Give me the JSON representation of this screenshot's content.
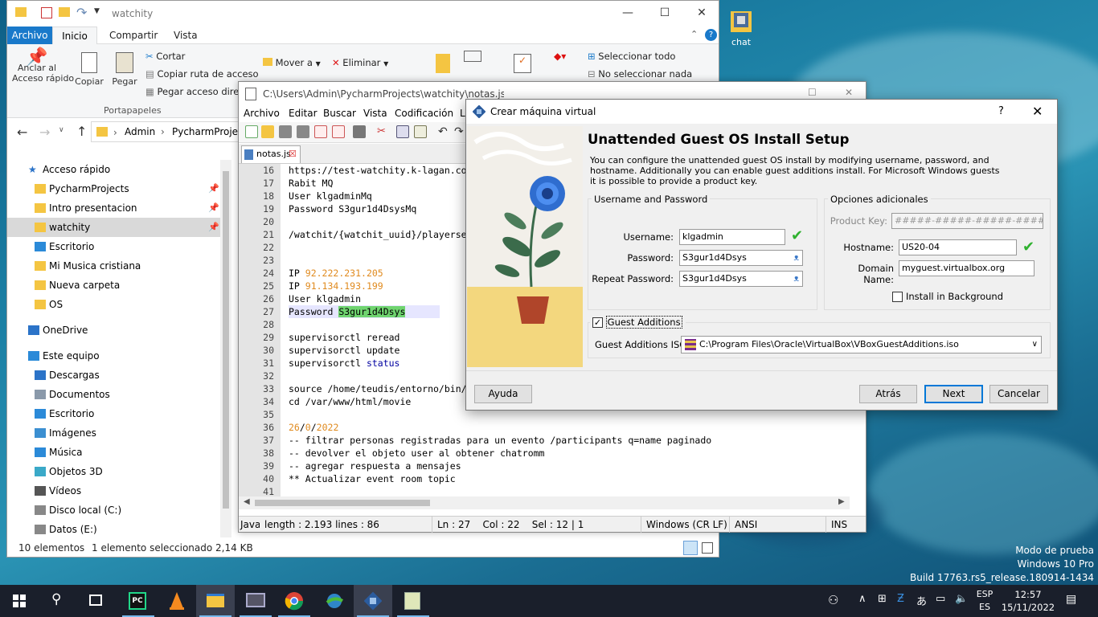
{
  "explorer": {
    "title": "watchity",
    "tabs": [
      "Archivo",
      "Inicio",
      "Compartir",
      "Vista"
    ],
    "ribbon": {
      "pin_label": "Anclar al\nAcceso rápido",
      "copy_label": "Copiar",
      "paste_label": "Pegar",
      "cut_label": "Cortar",
      "copy_path_label": "Copiar ruta de acceso",
      "paste_shortcut_label": "Pegar acceso direct",
      "group_clipboard": "Portapapeles",
      "move_label": "Mover a",
      "delete_label": "Eliminar",
      "select_all_label": "Seleccionar todo",
      "select_none_label": "No seleccionar nada"
    },
    "breadcrumb": [
      "Admin",
      "PycharmProject"
    ],
    "sidebar": [
      {
        "label": "Acceso rápido",
        "icon": "star-icon"
      },
      {
        "label": "PycharmProjects",
        "icon": "folder-icon"
      },
      {
        "label": "Intro presentacion",
        "icon": "folder-icon"
      },
      {
        "label": "watchity",
        "icon": "folder-icon"
      },
      {
        "label": "Escritorio",
        "icon": "desktop-icon"
      },
      {
        "label": "Mi Musica cristiana",
        "icon": "folder-icon"
      },
      {
        "label": "Nueva carpeta",
        "icon": "folder-icon"
      },
      {
        "label": "OS",
        "icon": "folder-icon"
      },
      {
        "label": "OneDrive",
        "icon": "cloud-icon"
      },
      {
        "label": "Este equipo",
        "icon": "computer-icon"
      },
      {
        "label": "Descargas",
        "icon": "download-icon"
      },
      {
        "label": "Documentos",
        "icon": "document-icon"
      },
      {
        "label": "Escritorio",
        "icon": "desktop-icon"
      },
      {
        "label": "Imágenes",
        "icon": "pictures-icon"
      },
      {
        "label": "Música",
        "icon": "music-icon"
      },
      {
        "label": "Objetos 3D",
        "icon": "cube-icon"
      },
      {
        "label": "Vídeos",
        "icon": "video-icon"
      },
      {
        "label": "Disco local (C:)",
        "icon": "drive-icon"
      },
      {
        "label": "Datos (E:)",
        "icon": "drive-icon"
      }
    ],
    "status_count": "10 elementos",
    "status_selected": "1 elemento seleccionado  2,14 KB"
  },
  "notepad": {
    "title": "C:\\Users\\Admin\\PycharmProjects\\watchity\\notas.js - Notepad",
    "menu": [
      "Archivo",
      "Editar",
      "Buscar",
      "Vista",
      "Codificación",
      "Le"
    ],
    "tab_name": "notas.js",
    "line_numbers": [
      "16",
      "17",
      "18",
      "19",
      "20",
      "21",
      "22",
      "23",
      "24",
      "25",
      "26",
      "27",
      "28",
      "29",
      "30",
      "31",
      "32",
      "33",
      "34",
      "35",
      "36",
      "37",
      "38",
      "39",
      "40",
      "41"
    ],
    "lines": [
      "https://test-watchity.k-lagan.co",
      "Rabit MQ",
      "User klgadminMq",
      "Password S3gur1d4DsysMq",
      "",
      "/watchit/{watchit_uuid}/playerse",
      "",
      "",
      "IP 92.222.231.205",
      "IP 91.134.193.199",
      "User klgadmin",
      "Password S3gur1d4Dsys",
      "",
      "supervisorctl reread",
      "supervisorctl update",
      "supervisorctl status",
      "",
      "source /home/teudis/entorno/bin/",
      "cd /var/www/html/movie",
      "",
      "26/0/2022",
      "-- filtrar personas registradas para un evento /participants q=name paginado",
      "-- devolver el objeto user al obtener chatromm",
      "-- agregar respuesta a mensajes",
      "** Actualizar event room topic",
      ""
    ],
    "status": {
      "type": "Java",
      "length": "length : 2.193    lines : 86",
      "pos": "Ln : 27    Col : 22    Sel : 12 | 1",
      "eol": "Windows (CR LF)",
      "enc": "ANSI",
      "mode": "INS"
    }
  },
  "dialog": {
    "title": "Crear máquina virtual",
    "help_glyph": "?",
    "heading": "Unattended Guest OS Install Setup",
    "description": "You can configure the unattended guest OS install by modifying username, password, and hostname. Additionally you can enable guest additions install. For Microsoft Windows guests it is possible to provide a product key.",
    "group_user": "Username and Password",
    "username_label": "Username:",
    "username_value": "klgadmin",
    "password_label": "Password:",
    "password_value": "S3gur1d4Dsys",
    "repeat_label": "Repeat Password:",
    "repeat_value": "S3gur1d4Dsys",
    "group_opts": "Opciones adicionales",
    "product_key_label": "Product Key:",
    "product_key_value": "#####-#####-#####-#####-#",
    "hostname_label": "Hostname:",
    "hostname_value": "US20-04",
    "domain_label": "Domain Name:",
    "domain_value": "myguest.virtualbox.org",
    "install_bg_label": "Install in Background",
    "guest_additions_label": "Guest Additions",
    "ga_iso_label": "Guest Additions ISO:",
    "ga_iso_value": "C:\\Program Files\\Oracle\\VirtualBox\\VBoxGuestAdditions.iso",
    "btn_help": "Ayuda",
    "btn_back": "Atrás",
    "btn_next": "Next",
    "btn_cancel": "Cancelar"
  },
  "desktop": {
    "icon_label": "chat",
    "watermark": [
      "Modo de prueba",
      "Windows 10 Pro",
      "Build 17763.rs5_release.180914-1434"
    ]
  },
  "taskbar": {
    "lang_top": "ESP",
    "lang_bottom": "ES",
    "time": "12:57",
    "date": "15/11/2022"
  },
  "colors": {
    "accent": "#1979ca",
    "check_green": "#2fb12f",
    "taskbar": "#1a1f2b"
  }
}
